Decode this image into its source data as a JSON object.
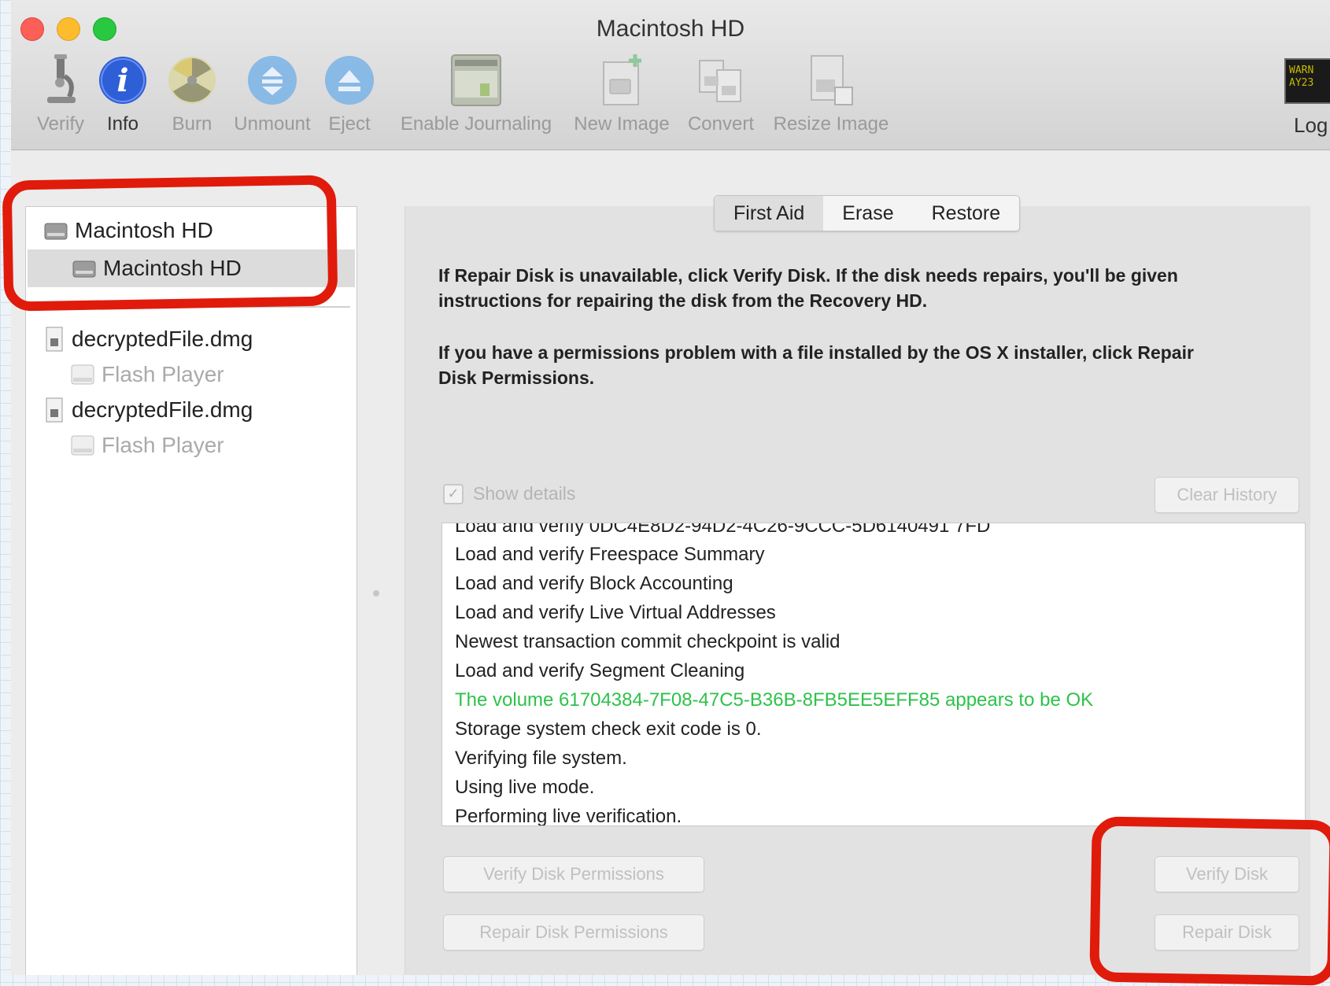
{
  "window": {
    "title": "Macintosh HD"
  },
  "toolbar": {
    "items": [
      {
        "label": "Verify",
        "icon": "microscope-icon"
      },
      {
        "label": "Info",
        "icon": "info-icon"
      },
      {
        "label": "Burn",
        "icon": "burn-icon"
      },
      {
        "label": "Unmount",
        "icon": "unmount-icon"
      },
      {
        "label": "Eject",
        "icon": "eject-icon"
      },
      {
        "label": "Enable Journaling",
        "icon": "journaling-icon"
      },
      {
        "label": "New Image",
        "icon": "new-image-icon"
      },
      {
        "label": "Convert",
        "icon": "convert-icon"
      },
      {
        "label": "Resize Image",
        "icon": "resize-image-icon"
      }
    ],
    "log_label": "Log",
    "log_thumb_text": "WARN\nAY23"
  },
  "sidebar": {
    "items": [
      {
        "label": "Macintosh HD",
        "enabled": true
      },
      {
        "label": "Macintosh HD",
        "enabled": true,
        "selected": true
      },
      {
        "label": "decryptedFile.dmg",
        "enabled": true
      },
      {
        "label": "Flash Player",
        "enabled": false
      },
      {
        "label": "decryptedFile.dmg",
        "enabled": true
      },
      {
        "label": "Flash Player",
        "enabled": false
      }
    ]
  },
  "tabs": [
    {
      "label": "First Aid",
      "active": true
    },
    {
      "label": "Erase",
      "active": false
    },
    {
      "label": "Restore",
      "active": false
    }
  ],
  "first_aid": {
    "para1_line1": "If Repair Disk is unavailable, click Verify Disk. If the disk needs repairs, you'll be given",
    "para1_line2": "instructions for repairing the disk from the Recovery HD.",
    "para2_line1": "If you have a permissions problem with a file installed by the OS X installer, click Repair",
    "para2_line2": "Disk Permissions.",
    "show_details_label": "Show details",
    "show_details_checked": true,
    "clear_history_label": "Clear History",
    "verify_permissions_label": "Verify Disk Permissions",
    "repair_permissions_label": "Repair Disk Permissions",
    "verify_disk_label": "Verify Disk",
    "repair_disk_label": "Repair Disk"
  },
  "log": {
    "lines": [
      {
        "text": "Load and verify 0DC4E8D2-94D2-4C26-9CCC-5D6140491 7FD",
        "status": "normal"
      },
      {
        "text": "Load and verify Freespace Summary",
        "status": "normal"
      },
      {
        "text": "Load and verify Block Accounting",
        "status": "normal"
      },
      {
        "text": "Load and verify Live Virtual Addresses",
        "status": "normal"
      },
      {
        "text": "Newest transaction commit checkpoint is valid",
        "status": "normal"
      },
      {
        "text": "Load and verify Segment Cleaning",
        "status": "normal"
      },
      {
        "text": "The volume 61704384-7F08-47C5-B36B-8FB5EE5EFF85 appears to be OK",
        "status": "ok"
      },
      {
        "text": "Storage system check exit code is 0.",
        "status": "normal"
      },
      {
        "text": "Verifying file system.",
        "status": "normal"
      },
      {
        "text": "Using live mode.",
        "status": "normal"
      },
      {
        "text": "Performing live verification.",
        "status": "normal"
      }
    ]
  },
  "colors": {
    "annotation": "#e01b0b",
    "ok_text": "#2ec24a",
    "info_blue": "#2f5fd6",
    "traffic_red": "#fc5f57",
    "traffic_yellow": "#fdbc2e",
    "traffic_green": "#28c840"
  }
}
